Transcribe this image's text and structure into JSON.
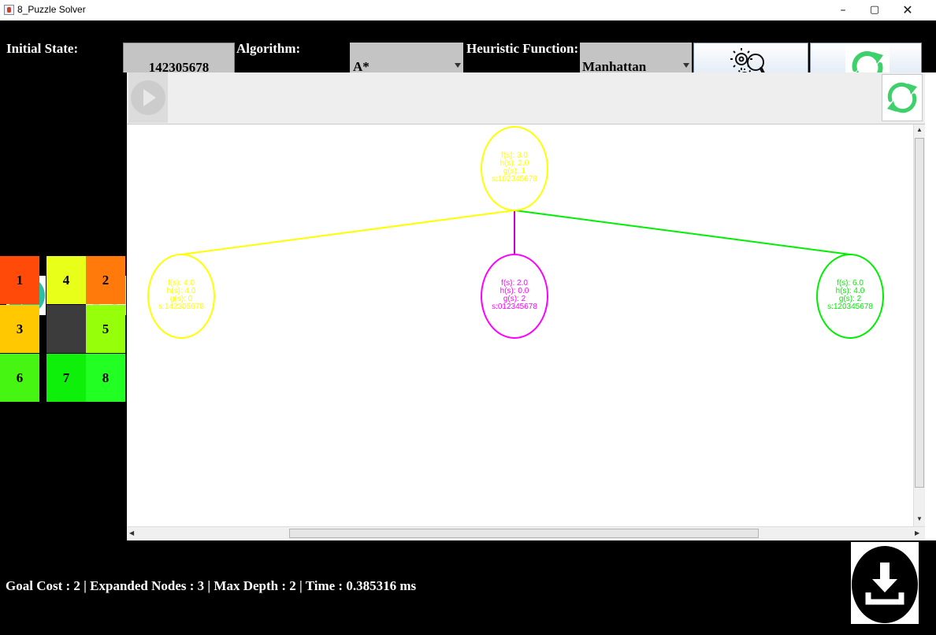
{
  "window": {
    "title": "8_Puzzle Solver",
    "controls": {
      "minimize": "–",
      "maximize": "▢",
      "close": "✕"
    }
  },
  "toolbar": {
    "initial_state_label": "Initial State:",
    "initial_state_value": "142305678",
    "algorithm_label": "Algorithm:",
    "algorithm_value": "A*",
    "heuristic_label": "Heuristic Function:",
    "heuristic_value": "Manhattan",
    "solve_icon": "gears-magnifier-icon",
    "reset_icon": "refresh-icon"
  },
  "board": {
    "tiles": [
      {
        "label": "1",
        "color": "#ff4a0a"
      },
      {
        "label": "4",
        "color": "#e8ff1a"
      },
      {
        "label": "2",
        "color": "#ff7a0a"
      },
      {
        "label": "3",
        "color": "#ffc800"
      },
      {
        "label": "",
        "color": "#3c3c3c"
      },
      {
        "label": "5",
        "color": "#96ff0a"
      },
      {
        "label": "6",
        "color": "#46f512"
      },
      {
        "label": "7",
        "color": "#0ef00a"
      },
      {
        "label": "8",
        "color": "#22ff22"
      }
    ],
    "play_icon": "play-icon",
    "replay_icon": "refresh-icon"
  },
  "tree": {
    "nodes": [
      {
        "id": "root",
        "color": "#ffff00",
        "f": "f(s): 3.0",
        "h": "h(s): 2.0",
        "g": "g(s): 1",
        "s": "s:102345678"
      },
      {
        "id": "left",
        "color": "#ffff00",
        "f": "f(s): 4.0",
        "h": "h(s): 4.0",
        "g": "g(s): 0",
        "s": "s:142305678"
      },
      {
        "id": "middle",
        "color": "#ff00ff",
        "f": "f(s): 2.0",
        "h": "h(s): 0.0",
        "g": "g(s): 2",
        "s": "s:012345678"
      },
      {
        "id": "right",
        "color": "#00ee00",
        "f": "f(s): 6.0",
        "h": "h(s): 4.0",
        "g": "g(s): 2",
        "s": "s:120345678"
      }
    ],
    "edges": [
      {
        "from": "root",
        "to": "left",
        "color": "#ffff00"
      },
      {
        "from": "root",
        "to": "middle",
        "color": "#cc00cc"
      },
      {
        "from": "root",
        "to": "right",
        "color": "#00ee00"
      }
    ]
  },
  "status": {
    "text": "Goal Cost : 2 | Expanded Nodes : 3 | Max Depth : 2 | Time : 0.385316 ms",
    "download_icon": "download-icon"
  },
  "colors": {
    "accent_teal": "#2bbfa4",
    "refresh_green": "#3ed06a",
    "panel_black": "#000000",
    "field_gray": "#c4c4c4"
  }
}
